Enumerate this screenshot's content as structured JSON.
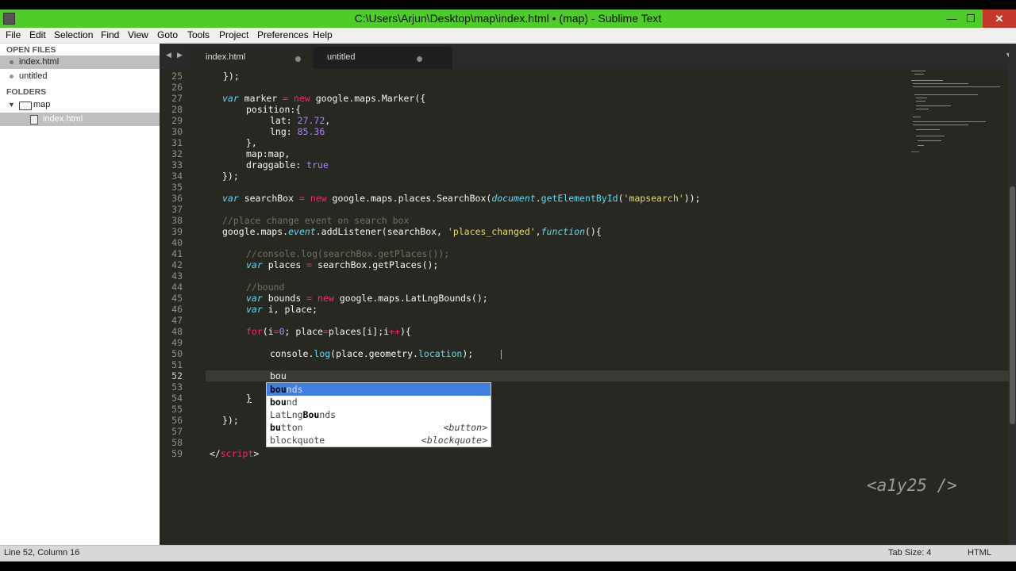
{
  "window": {
    "title": "C:\\Users\\Arjun\\Desktop\\map\\index.html • (map) - Sublime Text",
    "minimize_glyph": "—",
    "maximize_glyph": "❐",
    "close_glyph": "✕",
    "titlebar_color": "#4fcb2a"
  },
  "menu": [
    "File",
    "Edit",
    "Selection",
    "Find",
    "View",
    "Goto",
    "Tools",
    "Project",
    "Preferences",
    "Help"
  ],
  "sidebar": {
    "open_files_label": "OPEN FILES",
    "open_files": [
      "index.html",
      "untitled"
    ],
    "folders_label": "FOLDERS",
    "folder_name": "map",
    "folder_files": [
      "index.html"
    ]
  },
  "tabs": [
    {
      "label": "index.html",
      "active": true
    },
    {
      "label": "untitled",
      "active": false
    }
  ],
  "nav_arrows": {
    "back": "◀",
    "forward": "▶",
    "dropdown": "▼"
  },
  "editor": {
    "line_numbers": [
      "25",
      "26",
      "27",
      "28",
      "29",
      "30",
      "31",
      "32",
      "33",
      "34",
      "35",
      "36",
      "37",
      "38",
      "39",
      "40",
      "41",
      "42",
      "43",
      "44",
      "45",
      "46",
      "47",
      "48",
      "49",
      "50",
      "51",
      "52",
      "53",
      "54",
      "55",
      "56",
      "57",
      "58",
      "59"
    ],
    "current_line": "52",
    "code": {
      "l25": "});",
      "l27_kw": "var",
      "l27_a": " marker ",
      "l27_op": "=",
      "l27_new": " new",
      "l27_b": " google.maps.Marker({",
      "l28": "position:{",
      "l29_a": "lat: ",
      "l29_n": "27.72",
      "l29_b": ",",
      "l30_a": "lng: ",
      "l30_n": "85.36",
      "l31": "},",
      "l32": "map:map,",
      "l33_a": "draggable: ",
      "l33_n": "true",
      "l34": "});",
      "l36_kw": "var",
      "l36_a": " searchBox ",
      "l36_op": "=",
      "l36_new": " new",
      "l36_b": " google.maps.places.SearchBox(",
      "l36_doc": "document",
      "l36_c": ".",
      "l36_fn": "getElementById",
      "l36_d": "(",
      "l36_s": "'mapsearch'",
      "l36_e": "));",
      "l38": "//place change event on search box",
      "l39_a": "google.maps.",
      "l39_ev": "event",
      "l39_b": ".addListener(searchBox, ",
      "l39_s": "'places_changed'",
      "l39_c": ",",
      "l39_fn": "function",
      "l39_d": "(){",
      "l41": "//console.log(searchBox.getPlaces());",
      "l42_kw": "var",
      "l42_a": " places ",
      "l42_op": "=",
      "l42_b": " searchBox.getPlaces();",
      "l44": "//bound",
      "l45_kw": "var",
      "l45_a": " bounds ",
      "l45_op": "=",
      "l45_new": " new",
      "l45_b": " google.maps.LatLngBounds();",
      "l46_kw": "var",
      "l46_a": " i, place;",
      "l48_for": "for",
      "l48_a": "(i",
      "l48_op1": "=",
      "l48_n": "0",
      "l48_b": "; place",
      "l48_op2": "=",
      "l48_c": "places[i];i",
      "l48_op3": "++",
      "l48_d": "){",
      "l50_a": "console.",
      "l50_fn": "log",
      "l50_b": "(place.geometry.",
      "l50_fn2": "location",
      "l50_c": ");",
      "l52": "bou",
      "l54": "}",
      "l56": "});",
      "l59_a": "</",
      "l59_tag": "script",
      "l59_b": ">"
    }
  },
  "autocomplete": [
    {
      "match": "bou",
      "rest": "nds",
      "hint": ""
    },
    {
      "match": "bou",
      "rest": "nd",
      "hint": ""
    },
    {
      "pre": "LatLng",
      "match": "Bou",
      "rest": "nds",
      "hint": ""
    },
    {
      "match": "bu",
      "mid": "tt",
      "rest": "on",
      "hint": "<button>",
      "display": "button"
    },
    {
      "display": "blockquote",
      "hint": "<blockquote>"
    }
  ],
  "watermark": "<a1y25 />",
  "status": {
    "position": "Line 52, Column 16",
    "tab_size": "Tab Size: 4",
    "syntax": "HTML"
  }
}
